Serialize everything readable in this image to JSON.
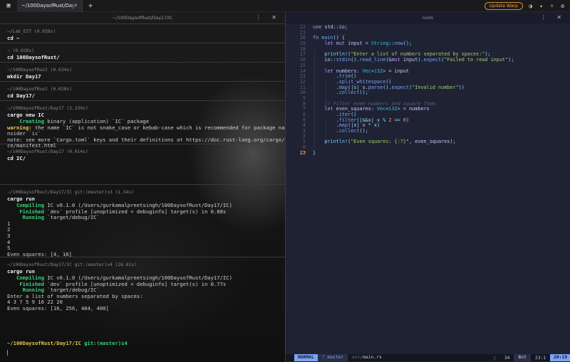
{
  "titlebar": {
    "tab_label": "~/100DaysofRust/Day17/IC",
    "tab_close": "✕",
    "new_tab": "+",
    "update_label": "Update Warp"
  },
  "left_pane": {
    "title": "~/100DaysofRust/Day17/IC",
    "controls": "⋮ ✕",
    "blocks": [
      {
        "dir": "~/Lab_EST (0.028s)",
        "cmd": "cd ~",
        "out": ""
      },
      {
        "dir": "~ (0.028s)",
        "cmd": "cd 100DaysofRust/",
        "out": ""
      },
      {
        "dir": "~/100DaysofRust (0.034s)",
        "cmd": "mkdir Day17",
        "out": ""
      },
      {
        "dir": "~/100DaysofRust (0.028s)",
        "cmd": "cd Day17/",
        "out": ""
      },
      {
        "dir": "~/100DaysofRust/Day17 (2.339s)",
        "cmd": "cargo new IC",
        "out": ""
      },
      {
        "dir": "~/100DaysofRust/Day17 (0.014s)",
        "cmd": "cd IC/",
        "out": ""
      },
      {
        "dir": "~/100DaysofRust/Day17/IC git:(master)±3 (1.54s)",
        "cmd": "cargo run",
        "out": ""
      },
      {
        "dir": "~/100DaysofRust/Day17/IC git:(master)±4 (26.61s)",
        "cmd": "cargo run",
        "out": ""
      }
    ],
    "new_output": {
      "creating": "Creating",
      "creating_rest": " binary (application) `IC` package",
      "warning": "warning:",
      "warning_rest": " the name `IC` is not snake_case or kebab-case which is recommended for package names, co",
      "warning_wrap": "nsider `ic`",
      "note1": "note: see more `Cargo.toml` keys and their definitions at https://doc.rust-lang.org/cargo/referen",
      "note2": "ce/manifest.html"
    },
    "run1": {
      "compiling": "Compiling",
      "compiling_rest": " IC v0.1.0 (/Users/gurkamalpreetsingh/100DaysofRust/Day17/IC)",
      "finished": "Finished",
      "finished_rest": " `dev` profile [unoptimized + debuginfo] target(s) in 0.88s",
      "running": "Running",
      "running_rest": " `target/debug/IC`",
      "lines": [
        "1",
        "2",
        "3",
        "4",
        "5",
        "Even squares: [4, 16]"
      ]
    },
    "run2": {
      "compiling": "Compiling",
      "compiling_rest": " IC v0.1.0 (/Users/gurkamalpreetsingh/100DaysofRust/Day17/IC)",
      "finished": "Finished",
      "finished_rest": " `dev` profile [unoptimized + debuginfo] target(s) in 0.77s",
      "running": "Running",
      "running_rest": " `target/debug/IC`",
      "lines": [
        "Enter a list of numbers separated by spaces:",
        "4 3 7 5 9 16 22 20",
        "Even squares: [16, 256, 484, 400]"
      ]
    },
    "prompt_dir": "~/100DaysofRust/Day17/IC",
    "prompt_git": " git:(master)±4"
  },
  "right_pane": {
    "title": "nvim",
    "controls": "⋮ ✕",
    "line_numbers": [
      "22",
      "21",
      "20",
      "19",
      "18",
      "17",
      "16",
      "15",
      "14",
      "13",
      "12",
      "11",
      "10",
      "9",
      "8",
      "7",
      "6",
      "5",
      "4",
      "3",
      "2",
      "1",
      "23"
    ],
    "status": {
      "mode": "NORMAL",
      "branch": "ᚠ master",
      "file_dir": "src/",
      "file_name": "main.rs",
      "arrow": "〈",
      "col": "34",
      "bot": "Bot",
      "pos": "23:1",
      "time": "20:19"
    }
  }
}
